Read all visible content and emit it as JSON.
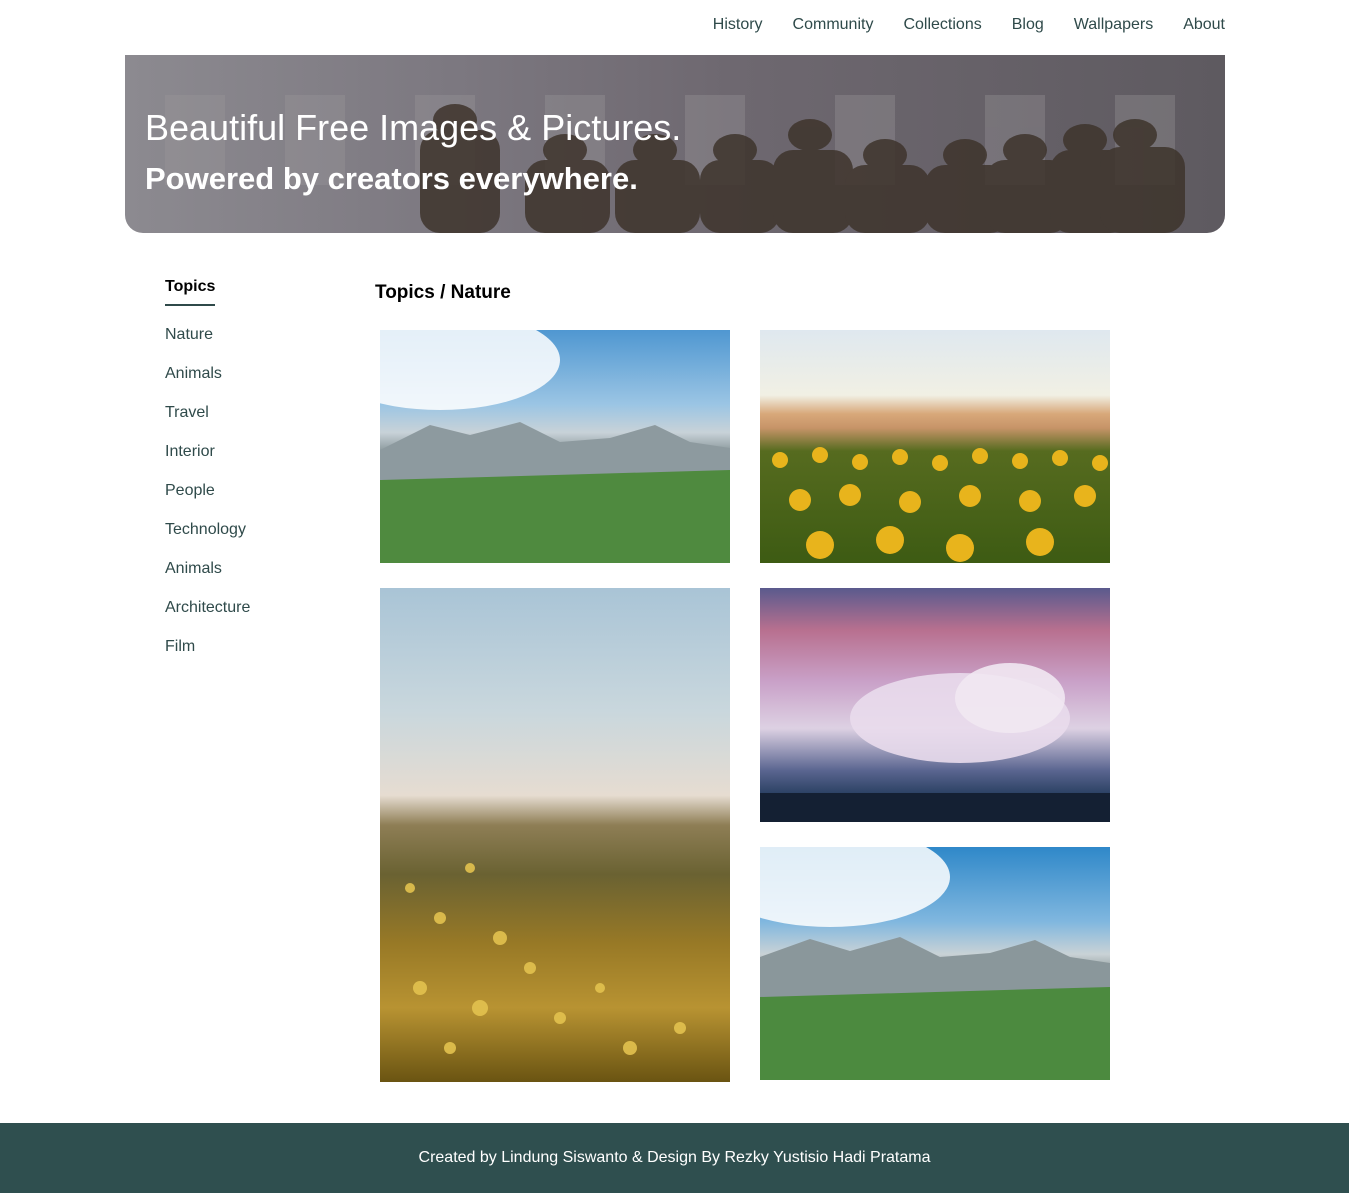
{
  "nav": {
    "items": [
      "History",
      "Community",
      "Collections",
      "Blog",
      "Wallpapers",
      "About"
    ]
  },
  "hero": {
    "title": "Beautiful Free Images & Pictures.",
    "subtitle": "Powered by creators everywhere."
  },
  "sidebar": {
    "heading": "Topics",
    "items": [
      "Nature",
      "Animals",
      "Travel",
      "Interior",
      "People",
      "Technology",
      "Animals",
      "Architecture",
      "Film"
    ]
  },
  "main": {
    "breadcrumb": "Topics / Nature"
  },
  "footer": {
    "text": "Created by Lindung Siswanto & Design By Rezky Yustisio Hadi Pratama"
  },
  "colors": {
    "footer_bg": "#2f4f4f",
    "nav_text": "#2f4a4a"
  }
}
